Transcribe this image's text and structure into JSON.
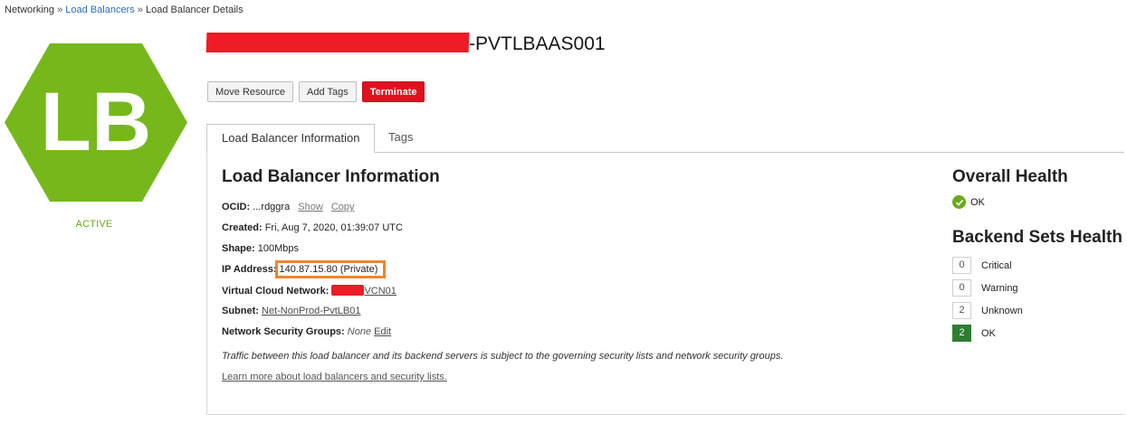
{
  "breadcrumb": {
    "items": [
      "Networking",
      "Load Balancers",
      "Load Balancer Details"
    ],
    "separator": "»"
  },
  "badge": {
    "text": "LB",
    "color": "#76b81c",
    "icon": "hexagon-lb-icon"
  },
  "status": "ACTIVE",
  "title": {
    "suffix": "-PVTLBAAS001"
  },
  "actions": {
    "move": "Move Resource",
    "tags": "Add Tags",
    "terminate": "Terminate"
  },
  "tabs": [
    {
      "label": "Load Balancer Information"
    },
    {
      "label": "Tags"
    }
  ],
  "info": {
    "heading": "Load Balancer Information",
    "ocid_label": "OCID:",
    "ocid_value": "...rdggra",
    "show": "Show",
    "copy": "Copy",
    "created_label": "Created:",
    "created_value": "Fri, Aug 7, 2020, 01:39:07 UTC",
    "shape_label": "Shape:",
    "shape_value": "100Mbps",
    "ip_label": "IP Address:",
    "ip_value": "140.87.15.80 (Private)",
    "vcn_label": "Virtual Cloud Network:",
    "vcn_value": "VCN01",
    "subnet_label": "Subnet:",
    "subnet_value": "Net-NonProd-PvtLB01",
    "nsg_label": "Network Security Groups:",
    "nsg_value": "None",
    "nsg_edit": "Edit",
    "note": "Traffic between this load balancer and its backend servers is subject to the governing security lists and network security groups.",
    "learn_more": "Learn more about load balancers and security lists."
  },
  "health": {
    "overall_heading": "Overall Health",
    "overall_status": "OK",
    "backend_heading": "Backend Sets Health",
    "rows": [
      {
        "count": "0",
        "label": "Critical"
      },
      {
        "count": "0",
        "label": "Warning"
      },
      {
        "count": "2",
        "label": "Unknown"
      },
      {
        "count": "2",
        "label": "OK"
      }
    ]
  },
  "colors": {
    "accent_link": "#2a6fb7",
    "danger": "#e0101f",
    "ok": "#2e7d32",
    "highlight": "#f4832a"
  }
}
